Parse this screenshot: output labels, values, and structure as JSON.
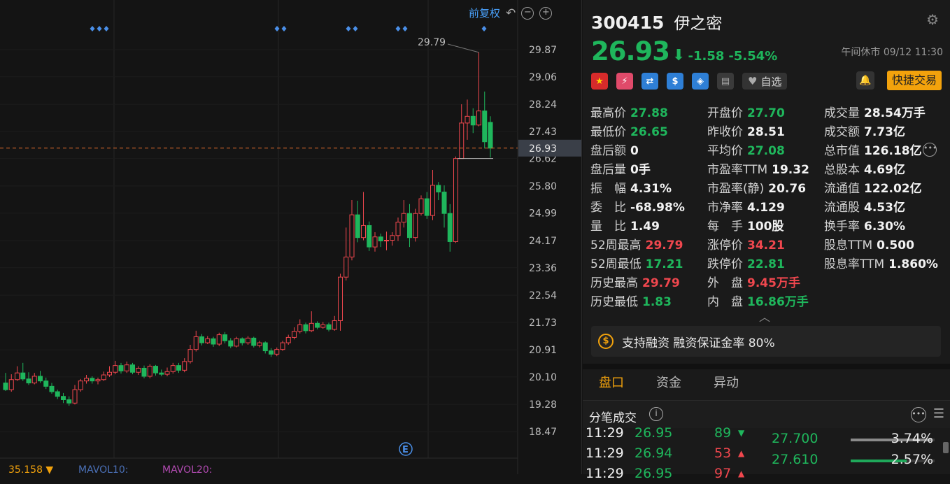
{
  "chart": {
    "adjust_label": "前复权",
    "y_ticks": [
      "29.87",
      "29.06",
      "28.24",
      "27.43",
      "26.62",
      "25.80",
      "24.99",
      "24.17",
      "23.36",
      "22.54",
      "21.73",
      "20.91",
      "20.10",
      "19.28",
      "18.47"
    ],
    "y_top": 29.87,
    "y_bottom": 18.47,
    "high_label": "29.79",
    "last_price_label": "26.93",
    "bottom_indicators": [
      {
        "label": "35.158 ▼",
        "color": "#f2a20c"
      },
      {
        "label": "MAVOL10:",
        "color": "#4a6fb5"
      },
      {
        "label": "MAVOL20:",
        "color": "#b04ab0"
      }
    ],
    "e_marker": "E"
  },
  "chart_data": {
    "type": "candlestick",
    "y_range": [
      18.47,
      29.87
    ],
    "last_price": 26.93,
    "candles": [
      [
        19.92,
        19.72,
        20.22,
        19.68
      ],
      [
        19.72,
        20.02,
        20.18,
        19.66
      ],
      [
        20.02,
        20.22,
        20.42,
        19.98
      ],
      [
        20.22,
        20.04,
        20.52,
        19.98
      ],
      [
        20.04,
        19.92,
        20.24,
        19.86
      ],
      [
        19.92,
        20.12,
        20.22,
        19.88
      ],
      [
        20.12,
        19.98,
        20.28,
        19.92
      ],
      [
        19.98,
        19.82,
        20.08,
        19.74
      ],
      [
        19.82,
        19.66,
        19.92,
        19.6
      ],
      [
        19.66,
        19.52,
        19.72,
        19.44
      ],
      [
        19.52,
        19.42,
        19.62,
        19.32
      ],
      [
        19.42,
        19.32,
        19.52,
        19.24
      ],
      [
        19.32,
        19.72,
        19.86,
        19.28
      ],
      [
        19.72,
        19.98,
        20.04,
        19.66
      ],
      [
        19.98,
        20.06,
        20.16,
        19.9
      ],
      [
        20.06,
        19.98,
        20.12,
        19.9
      ],
      [
        19.98,
        20.02,
        20.08,
        19.88
      ],
      [
        20.02,
        20.16,
        20.26,
        19.98
      ],
      [
        20.16,
        20.24,
        20.42,
        20.1
      ],
      [
        20.24,
        20.44,
        20.58,
        20.18
      ],
      [
        20.44,
        20.28,
        20.52,
        20.2
      ],
      [
        20.28,
        20.46,
        20.56,
        20.22
      ],
      [
        20.46,
        20.24,
        20.52,
        20.18
      ],
      [
        20.24,
        20.36,
        20.42,
        20.16
      ],
      [
        20.36,
        20.12,
        20.44,
        20.06
      ],
      [
        20.12,
        20.42,
        20.48,
        20.06
      ],
      [
        20.42,
        20.22,
        20.46,
        20.14
      ],
      [
        20.22,
        20.18,
        20.32,
        20.12
      ],
      [
        20.18,
        20.26,
        20.38,
        20.12
      ],
      [
        20.26,
        20.44,
        20.52,
        20.2
      ],
      [
        20.44,
        20.3,
        20.52,
        20.22
      ],
      [
        20.3,
        20.56,
        20.66,
        20.24
      ],
      [
        20.56,
        20.92,
        21.06,
        20.5
      ],
      [
        20.92,
        21.3,
        21.48,
        20.86
      ],
      [
        21.3,
        21.12,
        21.38,
        21.04
      ],
      [
        21.12,
        21.24,
        21.32,
        21.08
      ],
      [
        21.24,
        21.08,
        21.3,
        21.0
      ],
      [
        21.08,
        21.36,
        21.42,
        21.02
      ],
      [
        21.36,
        21.18,
        21.44,
        21.1
      ],
      [
        21.18,
        21.02,
        21.26,
        20.96
      ],
      [
        21.02,
        21.24,
        21.3,
        20.98
      ],
      [
        21.24,
        21.12,
        21.28,
        21.04
      ],
      [
        21.12,
        21.26,
        21.32,
        21.06
      ],
      [
        21.26,
        21.04,
        21.3,
        20.98
      ],
      [
        21.04,
        21.12,
        21.18,
        20.98
      ],
      [
        21.12,
        20.88,
        21.16,
        20.8
      ],
      [
        20.88,
        20.78,
        20.96,
        20.7
      ],
      [
        20.78,
        20.92,
        20.98,
        20.72
      ],
      [
        20.92,
        21.12,
        21.18,
        20.88
      ],
      [
        21.12,
        21.28,
        21.36,
        21.06
      ],
      [
        21.28,
        21.46,
        21.58,
        21.22
      ],
      [
        21.46,
        21.66,
        21.82,
        21.4
      ],
      [
        21.66,
        21.48,
        21.72,
        21.4
      ],
      [
        21.48,
        21.7,
        22.06,
        21.44
      ],
      [
        21.7,
        21.58,
        21.76,
        21.52
      ],
      [
        21.58,
        21.66,
        21.74,
        21.54
      ],
      [
        21.66,
        21.52,
        21.72,
        21.46
      ],
      [
        21.52,
        21.78,
        21.92,
        21.48
      ],
      [
        21.78,
        23.08,
        23.18,
        21.48
      ],
      [
        23.08,
        23.68,
        24.56,
        22.98
      ],
      [
        23.68,
        24.94,
        25.38,
        23.58
      ],
      [
        24.94,
        24.26,
        25.36,
        24.12
      ],
      [
        24.26,
        24.62,
        25.62,
        24.18
      ],
      [
        24.62,
        23.98,
        24.74,
        23.86
      ],
      [
        23.98,
        24.28,
        24.42,
        23.84
      ],
      [
        24.28,
        24.16,
        24.38,
        23.98
      ],
      [
        24.16,
        24.18,
        24.44,
        23.88
      ],
      [
        24.18,
        24.32,
        24.42,
        24.02
      ],
      [
        24.32,
        24.72,
        24.86,
        24.16
      ],
      [
        24.72,
        24.98,
        25.38,
        24.56
      ],
      [
        24.98,
        24.26,
        25.26,
        23.98
      ],
      [
        24.26,
        24.98,
        25.12,
        24.14
      ],
      [
        24.98,
        25.42,
        25.52,
        24.92
      ],
      [
        25.42,
        24.92,
        25.62,
        24.82
      ],
      [
        24.92,
        25.82,
        26.28,
        24.78
      ],
      [
        25.82,
        25.62,
        25.92,
        25.38
      ],
      [
        25.62,
        24.98,
        25.82,
        24.56
      ],
      [
        24.98,
        24.14,
        25.26,
        23.84
      ],
      [
        24.14,
        26.62,
        26.68,
        24.1
      ],
      [
        26.62,
        27.68,
        28.24,
        26.62
      ],
      [
        27.68,
        27.88,
        28.38,
        27.18
      ],
      [
        27.88,
        27.62,
        28.12,
        27.38
      ],
      [
        27.62,
        28.04,
        29.79,
        27.58
      ],
      [
        28.04,
        27.12,
        28.62,
        26.92
      ],
      [
        27.7,
        26.93,
        27.88,
        26.65
      ]
    ]
  },
  "quote": {
    "code": "300415",
    "name": "伊之密",
    "price": "26.93",
    "change": "-1.58",
    "change_pct": "-5.54%",
    "status": "午间休市 09/12 11:30",
    "fav_label": "自选",
    "quick_trade": "快捷交易"
  },
  "stats": [
    [
      {
        "l": "最高价",
        "v": "27.88",
        "c": "dn"
      },
      {
        "l": "最低价",
        "v": "26.65",
        "c": "dn"
      },
      {
        "l": "盘后额",
        "v": "0",
        "c": "wh"
      },
      {
        "l": "盘后量",
        "v": "0手",
        "c": "wh"
      },
      {
        "l": "振　幅",
        "v": "4.31%",
        "c": "wh"
      },
      {
        "l": "委　比",
        "v": "-68.98%",
        "c": "wh"
      },
      {
        "l": "量　比",
        "v": "1.49",
        "c": "wh"
      },
      {
        "l": "52周最高",
        "v": "29.79",
        "c": "up"
      },
      {
        "l": "52周最低",
        "v": "17.21",
        "c": "dn"
      },
      {
        "l": "历史最高",
        "v": "29.79",
        "c": "up"
      },
      {
        "l": "历史最低",
        "v": "1.83",
        "c": "dn"
      }
    ],
    [
      {
        "l": "开盘价",
        "v": "27.70",
        "c": "dn"
      },
      {
        "l": "昨收价",
        "v": "28.51",
        "c": "wh"
      },
      {
        "l": "平均价",
        "v": "27.08",
        "c": "dn"
      },
      {
        "l": "市盈率TTM",
        "v": "19.32",
        "c": "wh"
      },
      {
        "l": "市盈率(静)",
        "v": "20.76",
        "c": "wh"
      },
      {
        "l": "市净率",
        "v": "4.129",
        "c": "wh"
      },
      {
        "l": "每　手",
        "v": "100股",
        "c": "wh"
      },
      {
        "l": "涨停价",
        "v": "34.21",
        "c": "up"
      },
      {
        "l": "跌停价",
        "v": "22.81",
        "c": "dn"
      },
      {
        "l": "外　盘",
        "v": "9.45万手",
        "c": "up"
      },
      {
        "l": "内　盘",
        "v": "16.86万手",
        "c": "dn"
      }
    ],
    [
      {
        "l": "成交量",
        "v": "28.54万手",
        "c": "wh"
      },
      {
        "l": "成交额",
        "v": "7.73亿",
        "c": "wh"
      },
      {
        "l": "总市值",
        "v": "126.18亿",
        "c": "wh"
      },
      {
        "l": "总股本",
        "v": "4.69亿",
        "c": "wh"
      },
      {
        "l": "流通值",
        "v": "122.02亿",
        "c": "wh"
      },
      {
        "l": "流通股",
        "v": "4.53亿",
        "c": "wh"
      },
      {
        "l": "换手率",
        "v": "6.30%",
        "c": "wh"
      },
      {
        "l": "股息TTM",
        "v": "0.500",
        "c": "wh"
      },
      {
        "l": "股息率TTM",
        "v": "1.860%",
        "c": "wh"
      }
    ]
  ],
  "margin_text": "支持融资 融资保证金率 80%",
  "tabs": [
    "盘口",
    "资金",
    "异动"
  ],
  "ticks_title": "分笔成交",
  "ticks": [
    {
      "t": "11:29",
      "p": "26.95",
      "v": "89",
      "d": "dn"
    },
    {
      "t": "11:29",
      "p": "26.94",
      "v": "53",
      "d": "up"
    },
    {
      "t": "11:29",
      "p": "26.95",
      "v": "97",
      "d": "up"
    }
  ],
  "price_dist": [
    {
      "price": "27.700",
      "pct": "3.74%",
      "fill": 0.97,
      "color": "#8a8a8a"
    },
    {
      "price": "27.610",
      "pct": "2.57%",
      "fill": 0.67,
      "color": "#1fa85a"
    }
  ],
  "colors": {
    "up": "#f0474e",
    "down": "#1fb65c",
    "accent": "#f2a20c",
    "link": "#4aa3ff"
  }
}
